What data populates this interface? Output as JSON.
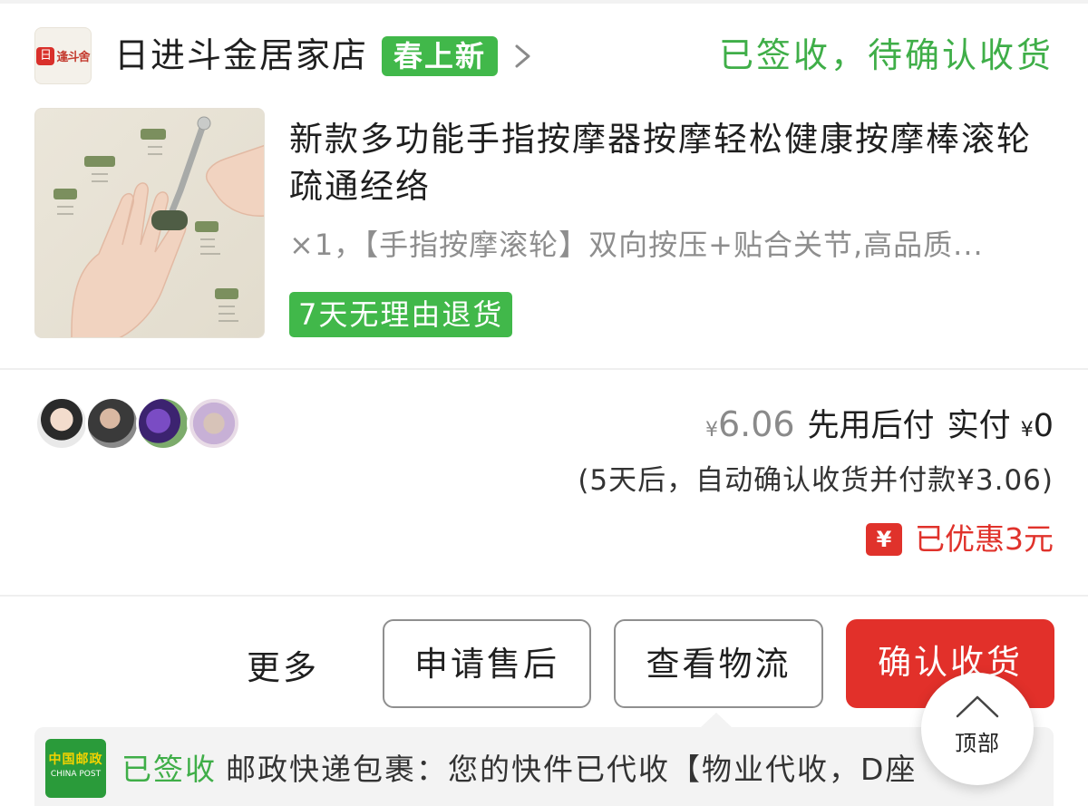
{
  "store": {
    "logo_text": "逢斗舍",
    "name": "日进斗金居家店",
    "badge": "春上新",
    "status": "已签收，待确认收货"
  },
  "product": {
    "image_alt": "手指按摩滚轮产品图",
    "title": "新款多功能手指按摩器按摩轻松健康按摩棒滚轮疏通经络",
    "spec": "×1，【手指按摩滚轮】双向按压+贴合关节,高品质...",
    "return_badge": "7天无理由退货"
  },
  "avatars": [
    "avatar-1",
    "avatar-2",
    "avatar-3",
    "avatar-4"
  ],
  "price": {
    "yen": "¥",
    "original": "6.06",
    "pay_later": "先用后付",
    "paid_label": "实付",
    "paid_amount": "0",
    "auto_confirm": "(5天后，自动确认收货并付款¥3.06)",
    "discount_icon": "¥",
    "discount": "已优惠3元"
  },
  "actions": {
    "more": "更多",
    "after_sale": "申请售后",
    "view_logistics": "查看物流",
    "confirm_receipt": "确认收货"
  },
  "logistics": {
    "carrier_logo_cn": "中国邮政",
    "carrier_logo_en": "CHINA POST",
    "status": "已签收",
    "message": "邮政快递包裹：您的快件已代收【物业代收，D座"
  },
  "back_to_top": {
    "label": "顶部"
  },
  "colors": {
    "accent_green": "#41b84a",
    "accent_red": "#e2302a",
    "muted_gray": "#8e8e8e"
  }
}
